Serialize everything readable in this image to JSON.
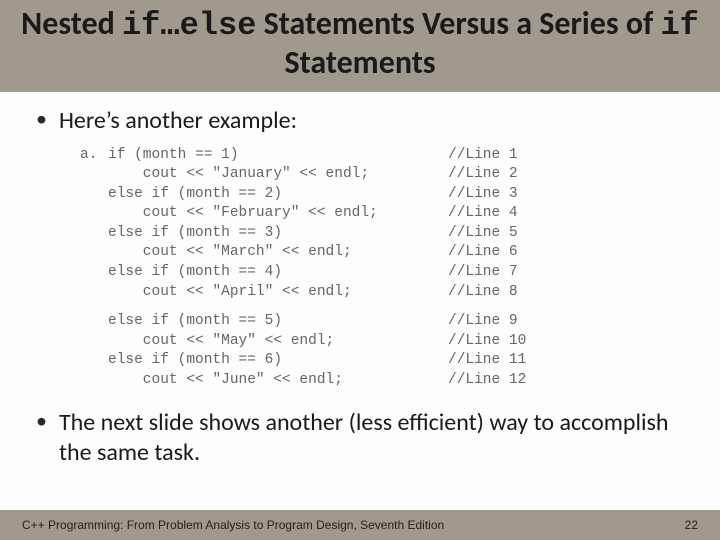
{
  "title": {
    "p1": "Nested ",
    "code": "if…else",
    "p2": " Statements Versus a Series of ",
    "code2": "if",
    "p3": " Statements"
  },
  "bullet1": "Here’s another example:",
  "code": {
    "label": "a.",
    "lines": [
      {
        "left": "if (month == 1)",
        "right": "//Line 1"
      },
      {
        "left": "    cout << \"January\" << endl;",
        "right": "//Line 2"
      },
      {
        "left": "else if (month == 2)",
        "right": "//Line 3"
      },
      {
        "left": "    cout << \"February\" << endl;",
        "right": "//Line 4"
      },
      {
        "left": "else if (month == 3)",
        "right": "//Line 5"
      },
      {
        "left": "    cout << \"March\" << endl;",
        "right": "//Line 6"
      },
      {
        "left": "else if (month == 4)",
        "right": "//Line 7"
      },
      {
        "left": "    cout << \"April\" << endl;",
        "right": "//Line 8"
      }
    ],
    "lines2": [
      {
        "left": "else if (month == 5)",
        "right": "//Line 9"
      },
      {
        "left": "    cout << \"May\" << endl;",
        "right": "//Line 10"
      },
      {
        "left": "else if (month == 6)",
        "right": "//Line 11"
      },
      {
        "left": "    cout << \"June\" << endl;",
        "right": "//Line 12"
      }
    ]
  },
  "bullet2": "The next slide shows another (less efficient) way to accomplish the same task.",
  "footer": {
    "left": "C++ Programming: From Problem Analysis to Program Design, Seventh Edition",
    "right": "22"
  }
}
